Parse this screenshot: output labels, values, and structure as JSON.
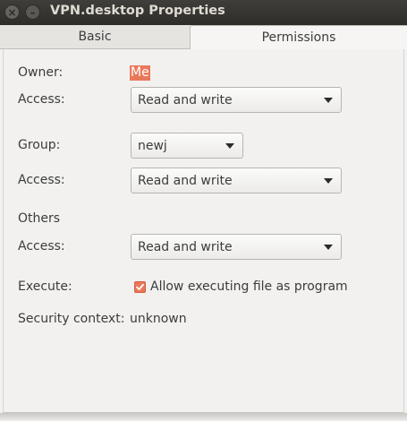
{
  "window": {
    "title": "VPN.desktop Properties",
    "close_glyph": "×",
    "minimize_glyph": "–"
  },
  "tabs": [
    {
      "label": "Basic",
      "active": false
    },
    {
      "label": "Permissions",
      "active": true
    }
  ],
  "permissions": {
    "owner_label": "Owner:",
    "owner_value": "Me",
    "owner_access_label": "Access:",
    "owner_access_value": "Read and write",
    "group_label": "Group:",
    "group_value": "newj",
    "group_access_label": "Access:",
    "group_access_value": "Read and write",
    "others_label": "Others",
    "others_access_label": "Access:",
    "others_access_value": "Read and write",
    "execute_label": "Execute:",
    "execute_checkbox_label": "Allow executing file as program",
    "execute_checked": true,
    "security_context_label": "Security context:",
    "security_context_value": "unknown"
  },
  "colors": {
    "accent": "#e9785a",
    "titlebar": "#3c3b37",
    "window_bg": "#f2f1f0"
  }
}
